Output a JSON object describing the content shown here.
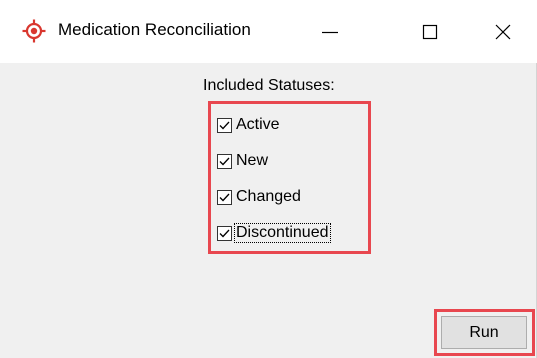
{
  "window": {
    "title": "Medication Reconciliation",
    "icon": "crosshair-target-icon",
    "controls": [
      "minimize",
      "maximize",
      "close"
    ]
  },
  "filters": {
    "label": "Included Statuses:",
    "statuses": [
      {
        "label": "Active",
        "checked": true
      },
      {
        "label": "New",
        "checked": true
      },
      {
        "label": "Changed",
        "checked": true
      },
      {
        "label": "Discontinued",
        "checked": true,
        "focused": true
      }
    ]
  },
  "actions": {
    "run_label": "Run"
  },
  "colors": {
    "highlight": "#e8474f",
    "icon": "#d9372f",
    "window_bg": "#f0f0f0"
  }
}
